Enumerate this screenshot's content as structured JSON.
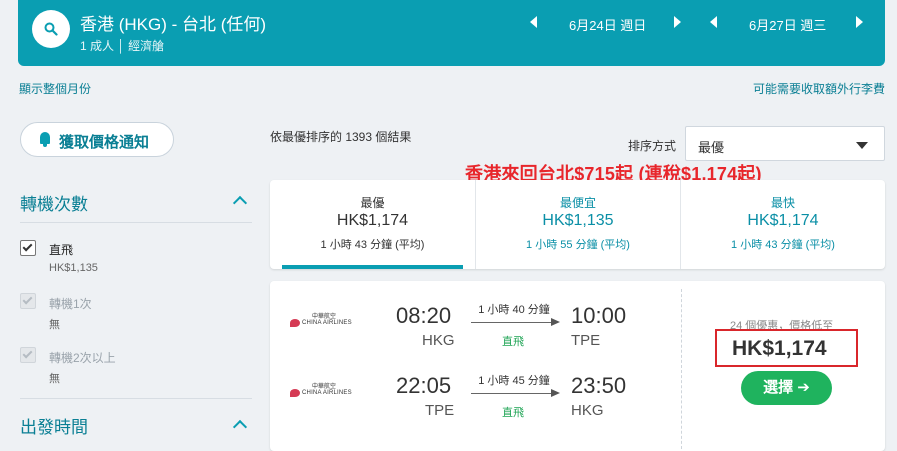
{
  "header": {
    "route": "香港 (HKG) - 台北 (任何)",
    "pax_class": "1 成人 │ 經濟艙",
    "depart_date": "6月24日 週日",
    "return_date": "6月27日 週三"
  },
  "links": {
    "show_month": "顯示整個月份",
    "baggage_fee": "可能需要收取額外行李費"
  },
  "sidebar": {
    "price_alert": "獲取價格通知",
    "stops_title": "轉機次數",
    "stops": [
      {
        "label": "直飛",
        "sub": "HK$1,135",
        "checked": true,
        "disabled": false
      },
      {
        "label": "轉機1次",
        "sub": "無",
        "checked": true,
        "disabled": true
      },
      {
        "label": "轉機2次以上",
        "sub": "無",
        "checked": true,
        "disabled": true
      }
    ],
    "depart_title": "出發時間"
  },
  "results": {
    "count_text": "依最優排序的 1393 個結果",
    "sort_label": "排序方式",
    "sort_value": "最優",
    "promo": "香港來回台北$715起 (連稅$1,174起)"
  },
  "tabs": [
    {
      "title": "最優",
      "price": "HK$1,174",
      "duration": "1 小時 43 分鐘 (平均)",
      "active": true
    },
    {
      "title": "最便宜",
      "price": "HK$1,135",
      "duration": "1 小時 55 分鐘 (平均)",
      "active": false
    },
    {
      "title": "最快",
      "price": "HK$1,174",
      "duration": "1 小時 43 分鐘 (平均)",
      "active": false
    }
  ],
  "flight_card": {
    "legs": [
      {
        "airline_cn": "中華航空",
        "airline": "CHINA AIRLINES",
        "dep_time": "08:20",
        "dep_code": "HKG",
        "duration": "1 小時 40 分鐘",
        "stops": "直飛",
        "arr_time": "10:00",
        "arr_code": "TPE"
      },
      {
        "airline_cn": "中華航空",
        "airline": "CHINA AIRLINES",
        "dep_time": "22:05",
        "dep_code": "TPE",
        "duration": "1 小時 45 分鐘",
        "stops": "直飛",
        "arr_time": "23:50",
        "arr_code": "HKG"
      }
    ],
    "deals_text": "24 個優惠，價格低至",
    "price": "HK$1,174",
    "select_label": "選擇 ➔"
  },
  "colors": {
    "header_bg": "#0a9eb2",
    "accent": "#0a7f94",
    "promo_red": "#e8262b",
    "select_green": "#1fb35e"
  }
}
